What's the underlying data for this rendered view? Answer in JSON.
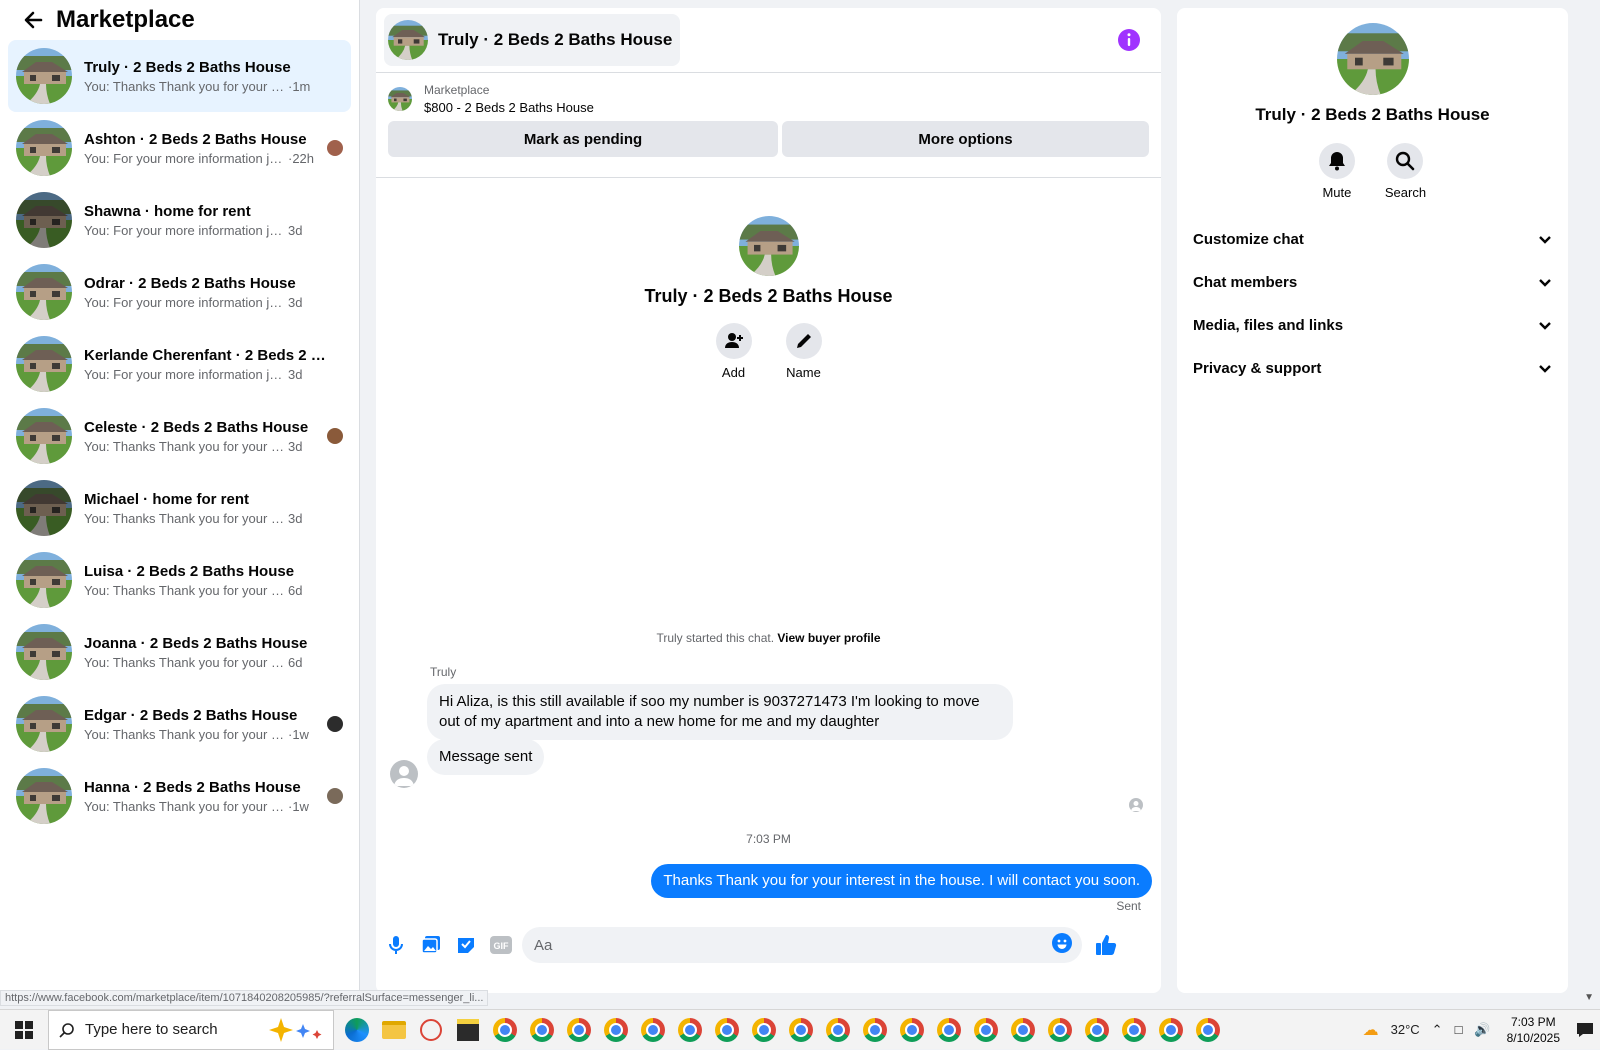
{
  "sidebar": {
    "title": "Marketplace",
    "conversations": [
      {
        "name": "Truly · 2 Beds 2 Baths House",
        "preview": "You: Thanks Thank you for your inter...",
        "time": "·1m",
        "active": true
      },
      {
        "name": "Ashton · 2 Beds 2 Baths House",
        "preview": "You: For your more information ju...",
        "time": "·22h"
      },
      {
        "name": "Shawna · home for rent",
        "preview": "You: For your more information just s...",
        "time": "3d"
      },
      {
        "name": "Odrar · 2 Beds 2 Baths House",
        "preview": "You: For your more information just s...",
        "time": "3d"
      },
      {
        "name": "Kerlande Cherenfant · 2 Beds 2 Bat...",
        "preview": "You: For your more information just s...",
        "time": "3d"
      },
      {
        "name": "Celeste · 2 Beds 2 Baths House",
        "preview": "You: Thanks Thank you for your int...",
        "time": "3d"
      },
      {
        "name": "Michael · home for rent",
        "preview": "You: Thanks Thank you for your intere...",
        "time": "3d"
      },
      {
        "name": "Luisa · 2 Beds 2 Baths House",
        "preview": "You: Thanks Thank you for your intere...",
        "time": "6d"
      },
      {
        "name": "Joanna · 2 Beds 2 Baths House",
        "preview": "You: Thanks Thank you for your intere...",
        "time": "6d"
      },
      {
        "name": "Edgar · 2 Beds 2 Baths House",
        "preview": "You: Thanks Thank you for your int...",
        "time": "·1w"
      },
      {
        "name": "Hanna · 2 Beds 2 Baths House",
        "preview": "You: Thanks Thank you for your int...",
        "time": "·1w"
      }
    ]
  },
  "chat": {
    "header_title": "Truly · 2 Beds 2 Baths House",
    "listing_source": "Marketplace",
    "listing_title": "$800 - 2 Beds 2 Baths House",
    "mark_pending": "Mark as pending",
    "more_options": "More options",
    "intro_name": "Truly · 2 Beds 2 Baths House",
    "add_label": "Add",
    "name_label": "Name",
    "started_text": "Truly started this chat.",
    "view_buyer": "View buyer profile",
    "sender": "Truly",
    "msg1": "Hi Aliza, is this still available if soo my number is 9037271473 I'm looking to move out of my apartment and into a new home for me and my daughter",
    "msg2": "Message sent",
    "time_separator": "7:03 PM",
    "outgoing": "Thanks Thank you for your interest in the house. I will contact you soon.",
    "sent_status": "Sent",
    "composer_placeholder": "Aa"
  },
  "right_panel": {
    "name": "Truly · 2 Beds 2 Baths House",
    "mute": "Mute",
    "search": "Search",
    "sections": [
      "Customize chat",
      "Chat members",
      "Media, files and links",
      "Privacy & support"
    ]
  },
  "status_url": "https://www.facebook.com/marketplace/item/1071840208205985/?referralSurface=messenger_li...",
  "taskbar": {
    "search_placeholder": "Type here to search",
    "weather": "32°C",
    "time": "7:03 PM",
    "date": "8/10/2025"
  },
  "colors": {
    "accent": "#0a7cff",
    "info": "#a033ff",
    "active_row": "#e7f3ff"
  }
}
